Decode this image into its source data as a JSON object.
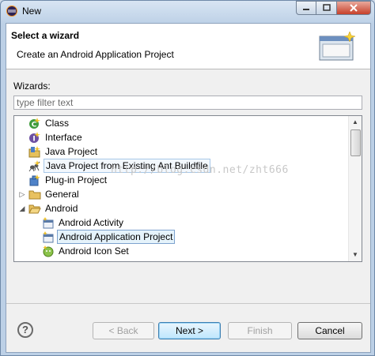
{
  "window": {
    "title": "New"
  },
  "header": {
    "title": "Select a wizard",
    "description": "Create an Android Application Project"
  },
  "wizards": {
    "label": "Wizards:",
    "filter_placeholder": "type filter text",
    "items": [
      {
        "label": "Class",
        "icon": "java-class-icon",
        "level": 1
      },
      {
        "label": "Interface",
        "icon": "java-interface-icon",
        "level": 1
      },
      {
        "label": "Java Project",
        "icon": "java-project-icon",
        "level": 1
      },
      {
        "label": "Java Project from Existing Ant Buildfile",
        "icon": "ant-project-icon",
        "level": 1
      },
      {
        "label": "Plug-in Project",
        "icon": "plugin-project-icon",
        "level": 1
      },
      {
        "label": "General",
        "icon": "folder-icon",
        "level": 0,
        "expander": "collapsed"
      },
      {
        "label": "Android",
        "icon": "folder-open-icon",
        "level": 0,
        "expander": "expanded"
      },
      {
        "label": "Android Activity",
        "icon": "android-activity-icon",
        "level": 2
      },
      {
        "label": "Android Application Project",
        "icon": "android-app-icon",
        "level": 2,
        "selected": true
      },
      {
        "label": "Android Icon Set",
        "icon": "android-icon-set-icon",
        "level": 2
      }
    ]
  },
  "watermark": "http://blog.csdn.net/zht666",
  "buttons": {
    "help": "?",
    "back": "< Back",
    "next": "Next >",
    "finish": "Finish",
    "cancel": "Cancel"
  },
  "colors": {
    "selection_border": "#7da2ce",
    "selection_fill": "#e5f3fb",
    "default_button": "#3c7fb1"
  }
}
